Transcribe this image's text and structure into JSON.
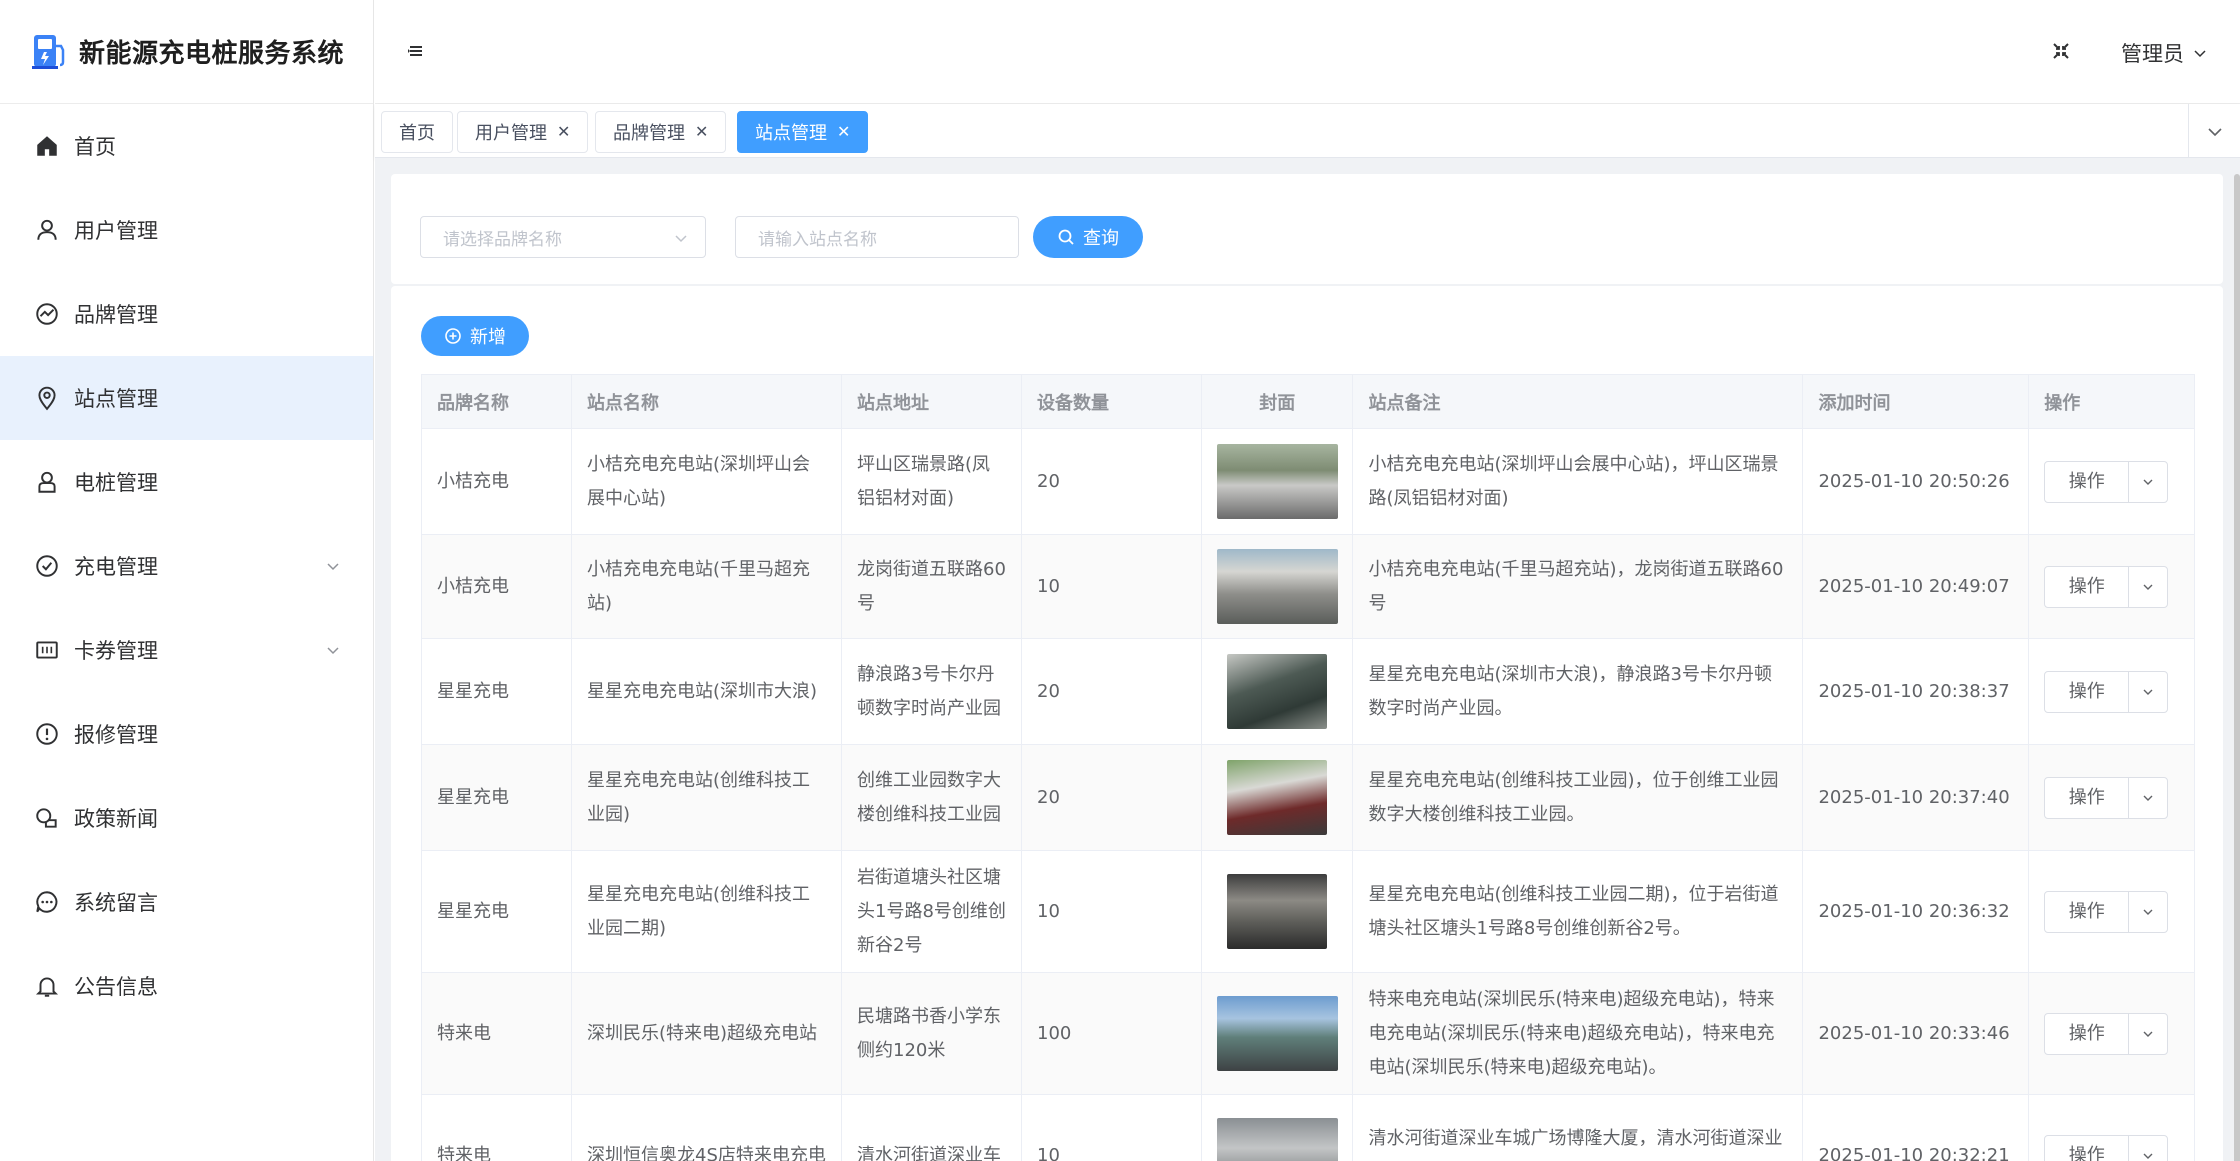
{
  "app": {
    "title": "新能源充电桩服务系统",
    "user_name": "管理员",
    "accent_color": "#409eff"
  },
  "sidebar": {
    "items": [
      {
        "label": "首页",
        "icon": "home-icon",
        "active": false
      },
      {
        "label": "用户管理",
        "icon": "user-icon",
        "active": false
      },
      {
        "label": "品牌管理",
        "icon": "brand-icon",
        "active": false
      },
      {
        "label": "站点管理",
        "icon": "location-icon",
        "active": true
      },
      {
        "label": "电桩管理",
        "icon": "charger-icon",
        "active": false
      },
      {
        "label": "充电管理",
        "icon": "check-circle-icon",
        "active": false,
        "expandable": true
      },
      {
        "label": "卡券管理",
        "icon": "coupon-icon",
        "active": false,
        "expandable": true
      },
      {
        "label": "报修管理",
        "icon": "warning-icon",
        "active": false
      },
      {
        "label": "政策新闻",
        "icon": "news-icon",
        "active": false
      },
      {
        "label": "系统留言",
        "icon": "message-icon",
        "active": false
      },
      {
        "label": "公告信息",
        "icon": "bell-icon",
        "active": false
      }
    ]
  },
  "tabs": [
    {
      "label": "首页",
      "closable": false,
      "active": false
    },
    {
      "label": "用户管理",
      "closable": true,
      "active": false
    },
    {
      "label": "品牌管理",
      "closable": true,
      "active": false
    },
    {
      "label": "站点管理",
      "closable": true,
      "active": true
    }
  ],
  "filter": {
    "brand_placeholder": "请选择品牌名称",
    "station_placeholder": "请输入站点名称",
    "query_label": "查询"
  },
  "toolbar": {
    "add_label": "新增"
  },
  "table": {
    "columns": [
      "品牌名称",
      "站点名称",
      "站点地址",
      "设备数量",
      "封面",
      "站点备注",
      "添加时间",
      "操作"
    ],
    "rows": [
      {
        "brand": "小桔充电",
        "name": "小桔充电充电站(深圳坪山会展中心站)",
        "address": "坪山区瑞景路(凤铝铝材对面)",
        "count": "20",
        "remark": "小桔充电充电站(深圳坪山会展中心站)，坪山区瑞景路(凤铝铝材对面)",
        "time": "2025-01-10 20:50:26",
        "op": "操作"
      },
      {
        "brand": "小桔充电",
        "name": "小桔充电充电站(千里马超充站)",
        "address": "龙岗街道五联路60号",
        "count": "10",
        "remark": "小桔充电充电站(千里马超充站)，龙岗街道五联路60号",
        "time": "2025-01-10 20:49:07",
        "op": "操作"
      },
      {
        "brand": "星星充电",
        "name": "星星充电充电站(深圳市大浪)",
        "address": "静浪路3号卡尔丹顿数字时尚产业园",
        "count": "20",
        "remark": "星星充电充电站(深圳市大浪)，静浪路3号卡尔丹顿数字时尚产业园。",
        "time": "2025-01-10 20:38:37",
        "op": "操作"
      },
      {
        "brand": "星星充电",
        "name": "星星充电充电站(创维科技工业园)",
        "address": "创维工业园数字大楼创维科技工业园",
        "count": "20",
        "remark": "星星充电充电站(创维科技工业园)，位于创维工业园数字大楼创维科技工业园。",
        "time": "2025-01-10 20:37:40",
        "op": "操作"
      },
      {
        "brand": "星星充电",
        "name": "星星充电充电站(创维科技工业园二期)",
        "address": "岩街道塘头社区塘头1号路8号创维创新谷2号",
        "count": "10",
        "remark": "星星充电充电站(创维科技工业园二期)，位于岩街道塘头社区塘头1号路8号创维创新谷2号。",
        "time": "2025-01-10 20:36:32",
        "op": "操作"
      },
      {
        "brand": "特来电",
        "name": "深圳民乐(特来电)超级充电站",
        "address": "民塘路书香小学东侧约120米",
        "count": "100",
        "remark": "特来电充电站(深圳民乐(特来电)超级充电站)，特来电充电站(深圳民乐(特来电)超级充电站)，特来电充电站(深圳民乐(特来电)超级充电站)。",
        "time": "2025-01-10 20:33:46",
        "op": "操作"
      },
      {
        "brand": "特来电",
        "name": "深圳恒信奥龙4S店特来电充电",
        "address": "清水河街道深业车",
        "count": "10",
        "remark": "清水河街道深业车城广场博隆大厦，清水河街道深业车城广场博隆大厦，清水河街道深业车城广场博隆大",
        "time": "2025-01-10 20:32:21",
        "op": "操作"
      }
    ]
  }
}
